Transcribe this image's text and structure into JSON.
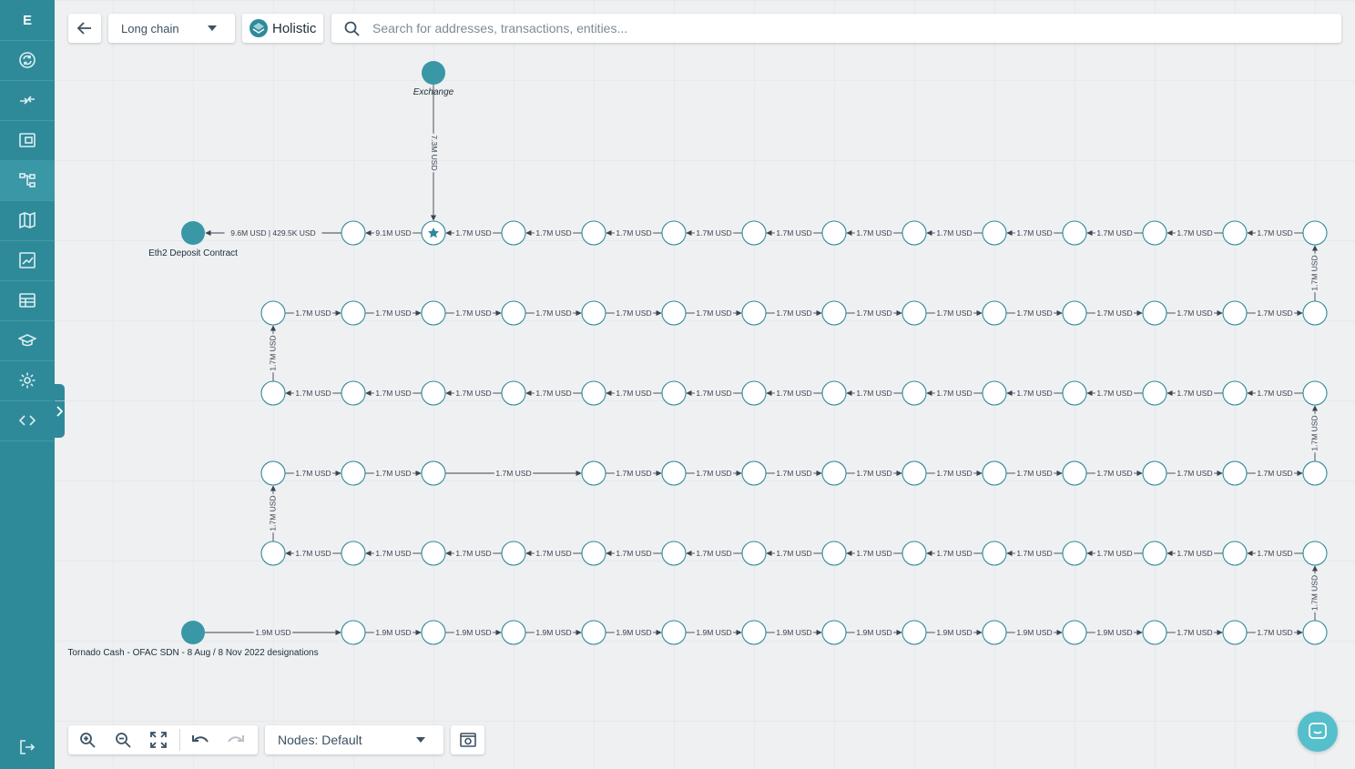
{
  "sidebar": {
    "logo": "E",
    "items": [
      {
        "name": "sidebar-item-transactions",
        "icon": "cycle-icon"
      },
      {
        "name": "sidebar-item-transfers",
        "icon": "arrows-icon"
      },
      {
        "name": "sidebar-item-wallets",
        "icon": "wallet-icon"
      },
      {
        "name": "sidebar-item-graph",
        "icon": "graph-icon",
        "active": true
      },
      {
        "name": "sidebar-item-map",
        "icon": "map-icon"
      },
      {
        "name": "sidebar-item-analytics",
        "icon": "chart-icon"
      },
      {
        "name": "sidebar-item-cases",
        "icon": "table-icon"
      },
      {
        "name": "sidebar-item-academy",
        "icon": "graduation-icon"
      },
      {
        "name": "sidebar-item-settings",
        "icon": "gear-icon"
      },
      {
        "name": "sidebar-item-developer",
        "icon": "code-icon"
      }
    ],
    "logout_icon": "logout-icon"
  },
  "toolbar": {
    "mode_select": "Long chain",
    "view_button": "Holistic",
    "search_placeholder": "Search for addresses, transactions, entities..."
  },
  "bottom_toolbar": {
    "nodes_select": "Nodes: Default"
  },
  "graph": {
    "exchange_label": "Exchange",
    "exchange_edge_label": "7.3M USD",
    "eth2_label": "Eth2 Deposit Contract",
    "eth2_edge_label": "9.6M USD  |  429.5K USD",
    "tornado_label": "Tornado Cash - OFAC SDN - 8 Aug / 8 Nov 2022 designations",
    "tornado_edge_label": "1.9M USD",
    "first_edge_label": "9.1M USD",
    "standard_edge_label": "1.7M USD",
    "row6_edge_label": "1.9M USD"
  },
  "colors": {
    "sidebar": "#2e8a99",
    "node_stroke": "#2f8a9a",
    "entity_fill": "#3a97a6",
    "chat": "#55bfcc"
  }
}
